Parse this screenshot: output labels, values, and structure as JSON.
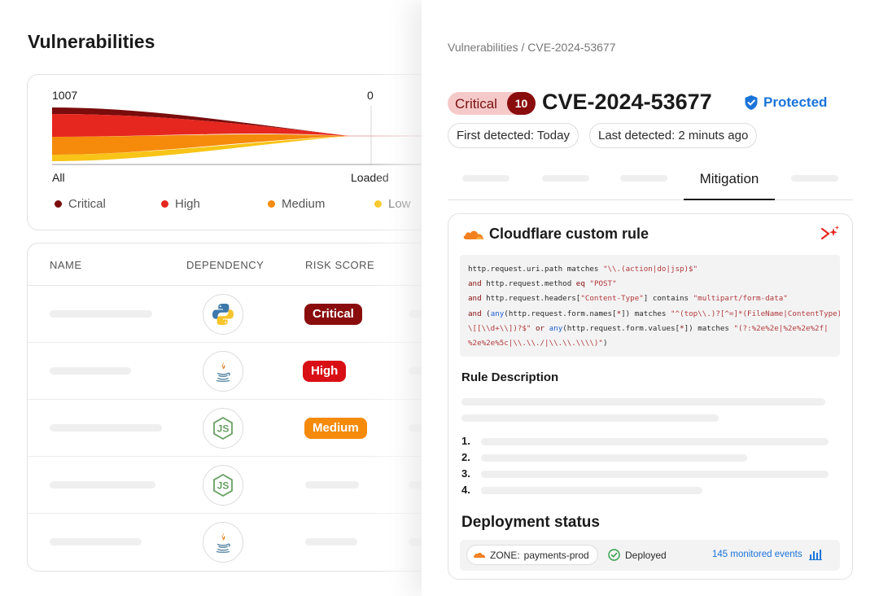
{
  "page": {
    "title": "Vulnerabilities"
  },
  "chart": {
    "max_label": "1007",
    "min_label": "0",
    "x_start_label": "All",
    "x_end_label": "Loaded",
    "legend": [
      {
        "label": "Critical",
        "color": "#7a0c0c"
      },
      {
        "label": "High",
        "color": "#e5271f"
      },
      {
        "label": "Medium",
        "color": "#f58a0b"
      },
      {
        "label": "Low",
        "color": "#f7c417"
      }
    ]
  },
  "table": {
    "headers": [
      "NAME",
      "DEPENDENCY",
      "RISK SCORE"
    ],
    "rows": [
      {
        "dependency_icon": "python-icon",
        "risk": "Critical",
        "risk_color": "#8a0d0d"
      },
      {
        "dependency_icon": "java-icon",
        "risk": "High",
        "risk_color": "#d90f16"
      },
      {
        "dependency_icon": "nodejs-icon",
        "risk": "Medium",
        "risk_color": "#f58a0b"
      },
      {
        "dependency_icon": "nodejs-icon",
        "risk": "",
        "risk_color": ""
      },
      {
        "dependency_icon": "java-icon",
        "risk": "",
        "risk_color": ""
      }
    ]
  },
  "detail": {
    "breadcrumb": "Vulnerabilities / CVE-2024-53677",
    "severity_label": "Critical",
    "severity_score": "10",
    "cve_id": "CVE-2024-53677",
    "status": "Protected",
    "first_detected": "First detected: Today",
    "last_detected": "Last detected: 2 minuts ago",
    "active_tab": "Mitigation",
    "rule": {
      "title": "Cloudflare custom rule",
      "description_heading": "Rule Description",
      "steps": [
        "1.",
        "2.",
        "3.",
        "4."
      ],
      "deployment_heading": "Deployment status",
      "zone_label": "ZONE:",
      "zone_value": "payments-prod",
      "deploy_state": "Deployed",
      "events": "145 monitored events"
    }
  }
}
